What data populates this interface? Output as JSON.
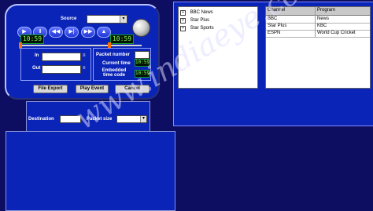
{
  "app": {
    "source_label": "Source",
    "source_value": "",
    "timecodes": {
      "left": "10:59",
      "right": "10:59",
      "current": "10:59",
      "embedded": "10:59"
    },
    "labels": {
      "in": "In",
      "out": "Out",
      "packet_number": "Packet number",
      "current_time": "Current time",
      "embedded_time": "Embedded time code",
      "destination": "Destination",
      "packet_size": "Packet size"
    },
    "buttons": {
      "file_export": "File Export",
      "play_event": "Play Event",
      "cancel": "Cancel"
    },
    "transport_icons": [
      "play-icon",
      "pause-icon",
      "rewind-icon",
      "skip-previous-icon",
      "skip-next-icon",
      "up-icon"
    ]
  },
  "tree": {
    "items": [
      "BBC News",
      "Star Plus",
      "Star Sports"
    ]
  },
  "table": {
    "headers": [
      "Channel",
      "Program"
    ],
    "rows": [
      [
        "BBC",
        "News"
      ],
      [
        "Star Plus",
        "KBC"
      ],
      [
        "ESPN",
        "World Cup Cricket"
      ]
    ]
  },
  "watermark": "www.indiaeye.com",
  "colors": {
    "background": "#0d0d62",
    "panel": "#0b24b8",
    "lcd_text": "#8bff52"
  }
}
